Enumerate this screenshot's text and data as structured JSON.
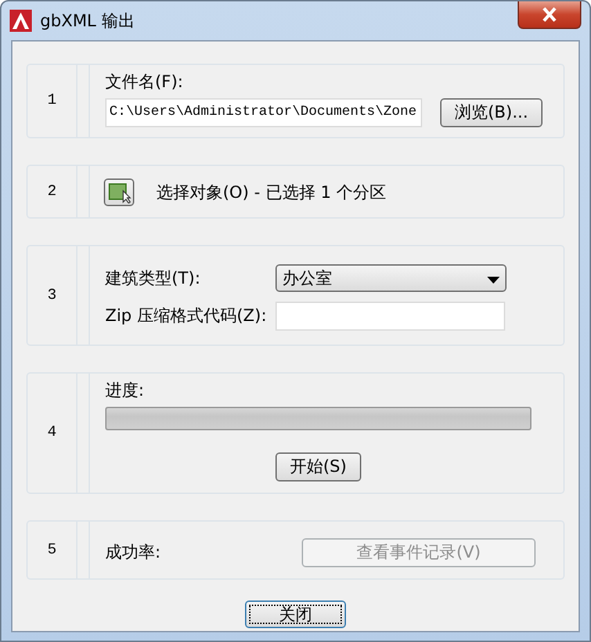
{
  "window": {
    "title": "gbXML 输出"
  },
  "sections": [
    {
      "number": "1",
      "kind": "file",
      "label": "文件名(F):",
      "value": "C:\\Users\\Administrator\\Documents\\Zone",
      "button": "浏览(B)..."
    },
    {
      "number": "2",
      "kind": "select",
      "label": "选择对象(O) - 已选择 1 个分区"
    },
    {
      "number": "3",
      "kind": "form",
      "type_label": "建筑类型(T):",
      "type_value": "办公室",
      "zip_label": "Zip 压缩格式代码(Z):"
    },
    {
      "number": "4",
      "kind": "progress",
      "label": "进度:",
      "level": 0,
      "button": "开始(S)"
    },
    {
      "number": "5",
      "kind": "result",
      "label": "成功率:",
      "button": "查看事件记录(V)",
      "button_disabled": true
    }
  ],
  "close_button": "关闭"
}
